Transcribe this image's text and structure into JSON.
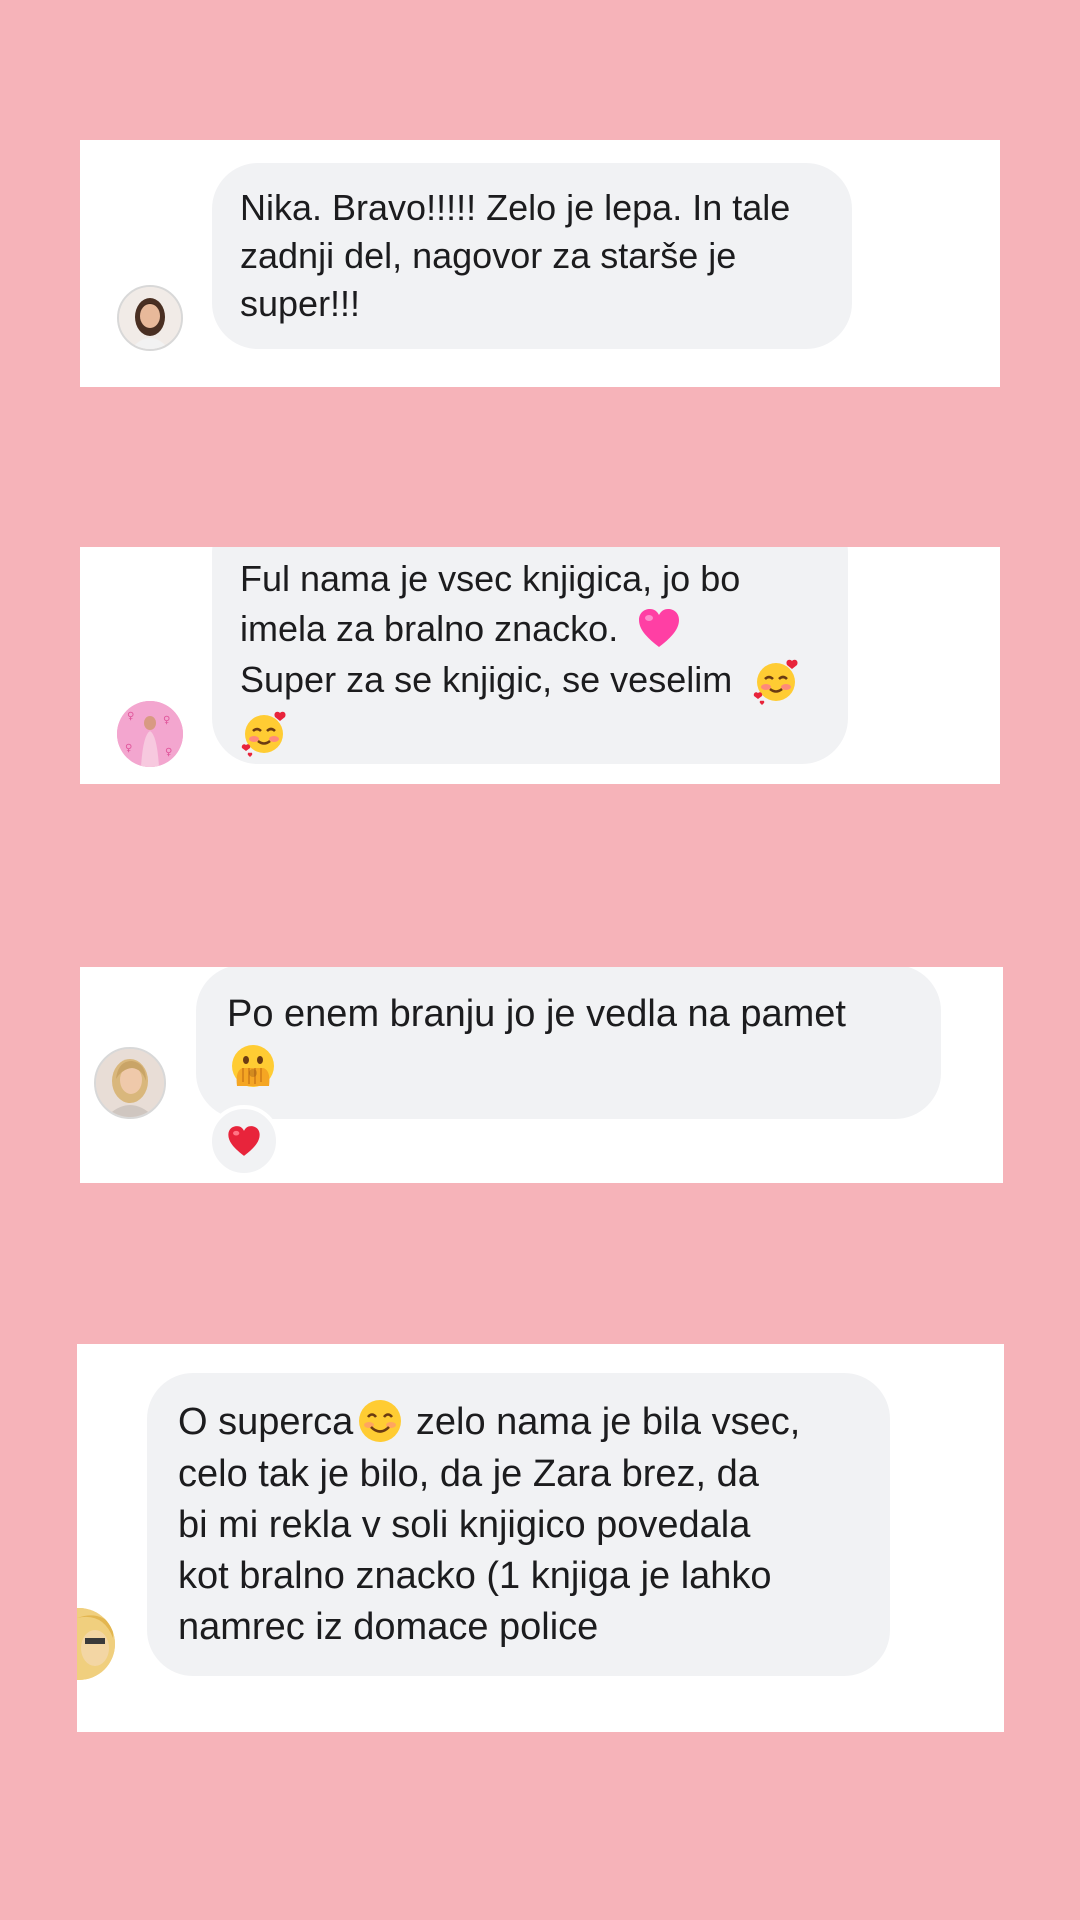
{
  "background_color": "#f6b3b9",
  "comments": [
    {
      "avatar": "avatar-woman-dark-hair",
      "lines": [
        "Nika. Bravo!!!!! Zelo je lepa. In tale",
        "zadnji del, nagovor za starše je",
        "super!!!"
      ]
    },
    {
      "avatar": "avatar-woman-pink-background",
      "line1": "Ful nama je vsec knjigica, jo bo",
      "line2": "imela za bralno znacko.",
      "line2_emoji": "pink-heart-emoji",
      "line3": "Super za se knjigic, se veselim",
      "line3_emoji": "smiling-face-with-hearts-emoji",
      "line4_emoji": "smiling-face-with-hearts-emoji"
    },
    {
      "avatar": "avatar-woman-blonde",
      "line1": "Po enem branju jo je vedla na pamet",
      "line2_emoji": "face-with-open-eyes-and-hand-over-mouth-emoji",
      "reaction": "red-heart-emoji"
    },
    {
      "avatar": "avatar-blonde-partial",
      "line1_a": "O superca",
      "line1_emoji": "smiling-face-with-smiling-eyes-emoji",
      "line1_b": " zelo nama je bila vsec,",
      "lines_rest": [
        "celo tak je bilo, da je Zara brez, da",
        "bi mi rekla v soli knjigico povedala",
        "kot bralno znacko (1 knjiga je lahko",
        "namrec iz domace police"
      ]
    }
  ]
}
